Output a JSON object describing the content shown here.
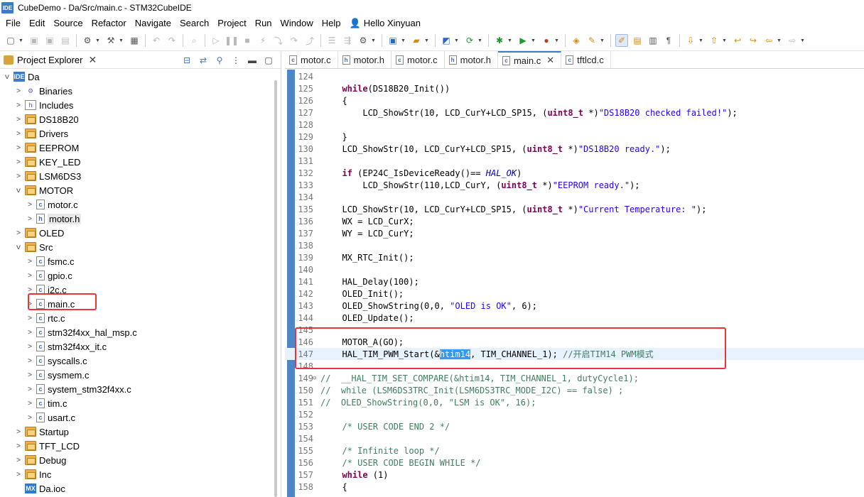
{
  "window": {
    "title": "CubeDemo - Da/Src/main.c - STM32CubeIDE",
    "app_icon_text": "IDE"
  },
  "menu": [
    "File",
    "Edit",
    "Source",
    "Refactor",
    "Navigate",
    "Search",
    "Project",
    "Run",
    "Window",
    "Help"
  ],
  "user_label": "Hello Xinyuan",
  "explorer": {
    "title": "Project Explorer",
    "tree": [
      {
        "label": "Da",
        "type": "project",
        "expanded": true,
        "depth": 0,
        "chev": "v",
        "icon": "IDE"
      },
      {
        "label": "Binaries",
        "type": "binaries",
        "depth": 1,
        "chev": ">",
        "icon": "⚙"
      },
      {
        "label": "Includes",
        "type": "includes",
        "depth": 1,
        "chev": ">",
        "icon": "h"
      },
      {
        "label": "DS18B20",
        "type": "folder",
        "depth": 1,
        "chev": ">",
        "icon": ""
      },
      {
        "label": "Drivers",
        "type": "folder",
        "depth": 1,
        "chev": ">",
        "icon": ""
      },
      {
        "label": "EEPROM",
        "type": "folder",
        "depth": 1,
        "chev": ">",
        "icon": ""
      },
      {
        "label": "KEY_LED",
        "type": "folder",
        "depth": 1,
        "chev": ">",
        "icon": ""
      },
      {
        "label": "LSM6DS3",
        "type": "folder",
        "depth": 1,
        "chev": ">",
        "icon": ""
      },
      {
        "label": "MOTOR",
        "type": "folder",
        "depth": 1,
        "chev": "v",
        "icon": ""
      },
      {
        "label": "motor.c",
        "type": "file",
        "depth": 2,
        "chev": ">",
        "icon": "c"
      },
      {
        "label": "motor.h",
        "type": "file",
        "depth": 2,
        "chev": ">",
        "icon": "h",
        "selected": true
      },
      {
        "label": "OLED",
        "type": "folder",
        "depth": 1,
        "chev": ">",
        "icon": ""
      },
      {
        "label": "Src",
        "type": "folder",
        "depth": 1,
        "chev": "v",
        "icon": ""
      },
      {
        "label": "fsmc.c",
        "type": "file",
        "depth": 2,
        "chev": ">",
        "icon": "c"
      },
      {
        "label": "gpio.c",
        "type": "file",
        "depth": 2,
        "chev": ">",
        "icon": "c"
      },
      {
        "label": "i2c.c",
        "type": "file",
        "depth": 2,
        "chev": ">",
        "icon": "c"
      },
      {
        "label": "main.c",
        "type": "file",
        "depth": 2,
        "chev": ">",
        "icon": "c"
      },
      {
        "label": "rtc.c",
        "type": "file",
        "depth": 2,
        "chev": ">",
        "icon": "c"
      },
      {
        "label": "stm32f4xx_hal_msp.c",
        "type": "file",
        "depth": 2,
        "chev": ">",
        "icon": "c"
      },
      {
        "label": "stm32f4xx_it.c",
        "type": "file",
        "depth": 2,
        "chev": ">",
        "icon": "c"
      },
      {
        "label": "syscalls.c",
        "type": "file",
        "depth": 2,
        "chev": ">",
        "icon": "c"
      },
      {
        "label": "sysmem.c",
        "type": "file",
        "depth": 2,
        "chev": ">",
        "icon": "c"
      },
      {
        "label": "system_stm32f4xx.c",
        "type": "file",
        "depth": 2,
        "chev": ">",
        "icon": "c"
      },
      {
        "label": "tim.c",
        "type": "file",
        "depth": 2,
        "chev": ">",
        "icon": "c"
      },
      {
        "label": "usart.c",
        "type": "file",
        "depth": 2,
        "chev": ">",
        "icon": "c"
      },
      {
        "label": "Startup",
        "type": "folder",
        "depth": 1,
        "chev": ">",
        "icon": ""
      },
      {
        "label": "TFT_LCD",
        "type": "folder",
        "depth": 1,
        "chev": ">",
        "icon": ""
      },
      {
        "label": "Debug",
        "type": "folder",
        "depth": 1,
        "chev": ">",
        "icon": ""
      },
      {
        "label": "Inc",
        "type": "folder",
        "depth": 1,
        "chev": ">",
        "icon": ""
      },
      {
        "label": "Da.ioc",
        "type": "ioc",
        "depth": 1,
        "chev": "",
        "icon": "MX"
      }
    ]
  },
  "editor": {
    "tabs": [
      {
        "label": "motor.c",
        "icon": "c",
        "active": false
      },
      {
        "label": "motor.h",
        "icon": "h",
        "active": false
      },
      {
        "label": "motor.c",
        "icon": "c",
        "active": false
      },
      {
        "label": "motor.h",
        "icon": "h",
        "active": false
      },
      {
        "label": "main.c",
        "icon": "c",
        "active": true
      },
      {
        "label": "tftlcd.c",
        "icon": "c",
        "active": false
      }
    ],
    "lines": [
      {
        "n": "124",
        "html": ""
      },
      {
        "n": "125",
        "html": "  <span class=\"kw\">while</span>(DS18B20_Init())"
      },
      {
        "n": "126",
        "html": "  {"
      },
      {
        "n": "127",
        "html": "      LCD_ShowStr(10, LCD_CurY+LCD_SP15, (<span class=\"kw\">uint8_t</span> *)<span class=\"str\">\"DS18B20 checked failed!\"</span>);"
      },
      {
        "n": "128",
        "html": ""
      },
      {
        "n": "129",
        "html": "  }"
      },
      {
        "n": "130",
        "html": "  LCD_ShowStr(10, LCD_CurY+LCD_SP15, (<span class=\"kw\">uint8_t</span> *)<span class=\"str\">\"DS18B20 ready.\"</span>);"
      },
      {
        "n": "131",
        "html": ""
      },
      {
        "n": "132",
        "html": "  <span class=\"kw\">if</span> (EP24C_IsDeviceReady()== <span class=\"mac\">HAL_OK</span>)"
      },
      {
        "n": "133",
        "html": "      LCD_ShowStr(110,LCD_CurY, (<span class=\"kw\">uint8_t</span> *)<span class=\"str\">\"EEPROM ready.\"</span>);"
      },
      {
        "n": "134",
        "html": ""
      },
      {
        "n": "135",
        "html": "  LCD_ShowStr(10, LCD_CurY+LCD_SP15, (<span class=\"kw\">uint8_t</span> *)<span class=\"str\">\"Current Temperature: \"</span>);"
      },
      {
        "n": "136",
        "html": "  WX = LCD_CurX;"
      },
      {
        "n": "137",
        "html": "  WY = LCD_CurY;"
      },
      {
        "n": "138",
        "html": ""
      },
      {
        "n": "139",
        "html": "  MX_RTC_Init();"
      },
      {
        "n": "140",
        "html": ""
      },
      {
        "n": "141",
        "html": "  HAL_Delay(100);"
      },
      {
        "n": "142",
        "html": "  OLED_Init();"
      },
      {
        "n": "143",
        "html": "  OLED_ShowString(0,0, <span class=\"str\">\"OLED is OK\"</span>, 6);"
      },
      {
        "n": "144",
        "html": "  OLED_Update();"
      },
      {
        "n": "145",
        "html": ""
      },
      {
        "n": "146",
        "html": "  MOTOR_A(GO);"
      },
      {
        "n": "147",
        "html": "  HAL_TIM_PWM_Start(&amp;<span class=\"sel\">htim14</span>, TIM_CHANNEL_1); <span style=\"color:#3f7f5f\">//开启TIM14 PWM模式</span>",
        "current": true
      },
      {
        "n": "148",
        "html": ""
      },
      {
        "n": "149",
        "html": "<span style=\"color:#3f7f5f\">//  __HAL_TIM_SET_COMPARE(&amp;htim14, TIM_CHANNEL_1, dutyCycle1);</span>",
        "fold": true,
        "shift": true
      },
      {
        "n": "150",
        "html": "<span style=\"color:#3f7f5f\">//  while (LSM6DS3TRC_Init(LSM6DS3TRC_MODE_I2C) == false) ;</span>",
        "shift": true
      },
      {
        "n": "151",
        "html": "<span style=\"color:#3f7f5f\">//  OLED_ShowString(0,0, \"LSM is OK\", 16);</span>",
        "shift": true
      },
      {
        "n": "152",
        "html": ""
      },
      {
        "n": "153",
        "html": "  <span style=\"color:#3f7f5f\">/* USER CODE END 2 */</span>"
      },
      {
        "n": "154",
        "html": ""
      },
      {
        "n": "155",
        "html": "  <span style=\"color:#3f7f5f\">/* Infinite loop */</span>"
      },
      {
        "n": "156",
        "html": "  <span style=\"color:#3f7f5f\">/* USER CODE BEGIN WHILE */</span>"
      },
      {
        "n": "157",
        "html": "  <span class=\"kw\">while</span> (1)"
      },
      {
        "n": "158",
        "html": "  {"
      }
    ]
  },
  "colors": {
    "accent": "#3a7cc8",
    "highlight_box": "#e8353a",
    "selection": "#3399ff"
  }
}
